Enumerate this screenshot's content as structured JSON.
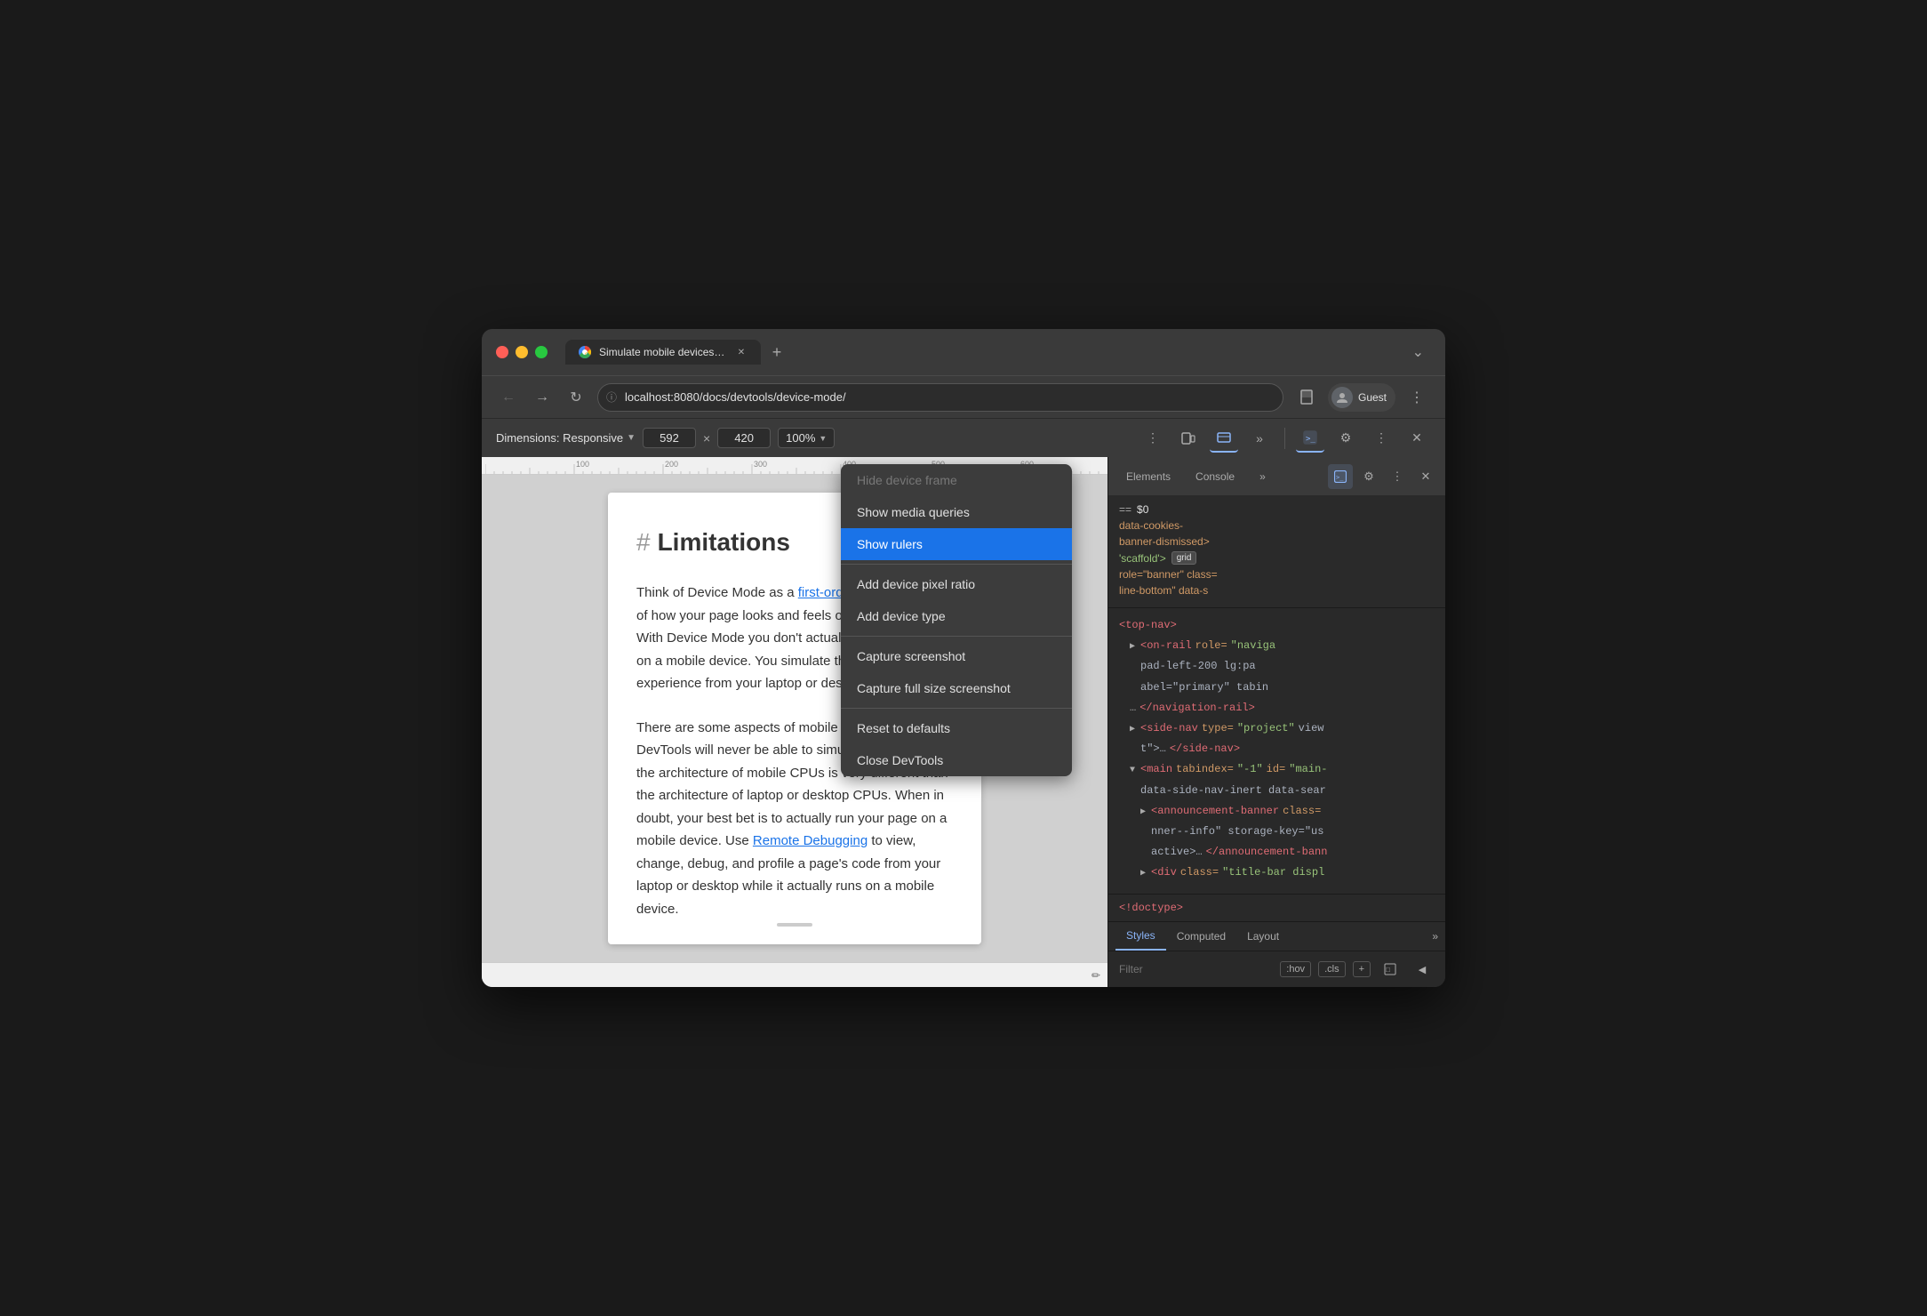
{
  "window": {
    "title": "Simulate mobile devices with D",
    "url": "localhost:8080/docs/devtools/device-mode/",
    "profile": "Guest"
  },
  "tabs": [
    {
      "label": "Simulate mobile devices with D",
      "active": true
    }
  ],
  "toolbar": {
    "dimensions_label": "Dimensions: Responsive",
    "width_value": "592",
    "height_value": "420",
    "zoom_value": "100%",
    "chevron": "▼"
  },
  "page": {
    "heading_hash": "#",
    "heading": "Limitations",
    "paragraph1_prefix": "Think of Device Mode as a ",
    "paragraph1_link": "first-order approximation",
    "paragraph1_suffix": " of how your page looks and feels on a mobile device. With Device Mode you don't actually run your code on a mobile device. You simulate the mobile user experience from your laptop or desktop.",
    "paragraph2_prefix": "There are some aspects of mobile devices that DevTools will never be able to simulate. For example, the architecture of mobile CPUs is very different than the architecture of laptop or desktop CPUs. When in doubt, your best bet is to actually run your page on a mobile device. Use ",
    "paragraph2_link": "Remote Debugging",
    "paragraph2_suffix": " to view, change, debug, and profile a page's code from your laptop or desktop while it actually runs on a mobile device."
  },
  "dropdown": {
    "items": [
      {
        "label": "Hide device frame",
        "state": "normal",
        "id": "hide-device-frame"
      },
      {
        "label": "Show media queries",
        "state": "normal",
        "id": "show-media-queries"
      },
      {
        "label": "Show rulers",
        "state": "selected",
        "id": "show-rulers"
      },
      {
        "label": "Add device pixel ratio",
        "state": "normal",
        "id": "add-device-pixel-ratio"
      },
      {
        "label": "Add device type",
        "state": "normal",
        "id": "add-device-type"
      },
      {
        "label": "Capture screenshot",
        "state": "normal",
        "id": "capture-screenshot"
      },
      {
        "label": "Capture full size screenshot",
        "state": "normal",
        "id": "capture-full-size"
      },
      {
        "label": "Reset to defaults",
        "state": "normal",
        "id": "reset-defaults"
      },
      {
        "label": "Close DevTools",
        "state": "normal",
        "id": "close-devtools"
      }
    ]
  },
  "devtools": {
    "element_eq": "==",
    "element_var": "$0",
    "dom_lines": [
      {
        "content": "data-cookies-banner-dismissed>"
      },
      {
        "content": "role=\"banner\" class="
      },
      {
        "content": "'scaffold'>"
      },
      {
        "content": "role=\"banner\" class="
      },
      {
        "content": "line-bottom\" data-s"
      },
      {
        "content": "top-nav>"
      },
      {
        "content": "on-rail role=\"naviga"
      },
      {
        "content": "pad-left-200 lg:pa"
      },
      {
        "content": "abel=\"primary\" tabin"
      },
      {
        "content": "…</navigation-rail>"
      },
      {
        "content": "<side-nav type=\"project\" view"
      },
      {
        "content": "t\">…</side-nav>"
      },
      {
        "content": "<main tabindex=\"-1\" id=\"main-"
      },
      {
        "content": "data-side-nav-inert data-sear"
      },
      {
        "content": "<announcement-banner class="
      },
      {
        "content": "nner--info\" storage-key=\"us"
      },
      {
        "content": "active>…</announcement-bann"
      },
      {
        "content": "<div class=\"title-bar displ"
      }
    ],
    "badge_label": "grid",
    "doctype": "<!doctype>",
    "styles_tabs": [
      "Styles",
      "Computed",
      "Layout"
    ],
    "styles_filter_placeholder": "Filter",
    "styles_hov": ":hov",
    "styles_cls": ".cls"
  }
}
